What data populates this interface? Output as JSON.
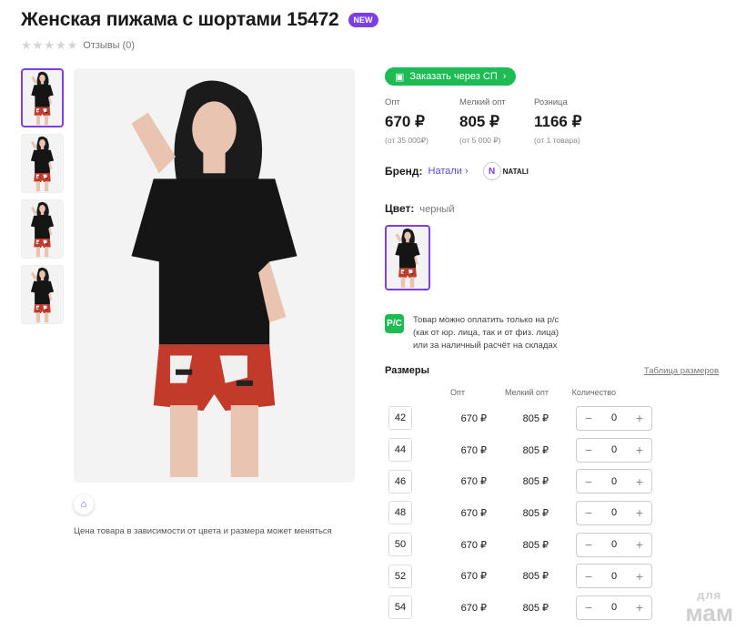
{
  "product": {
    "title": "Женская пижама с шортами 15472",
    "badge": "NEW",
    "reviews": "Отзывы (0)"
  },
  "gallery": {
    "price_note": "Цена товара в зависимости от цвета и размера может меняться"
  },
  "order": {
    "sp_button": "Заказать через СП"
  },
  "prices": [
    {
      "label": "Опт",
      "value": "670 ₽",
      "sub": "(от 35 000₽)"
    },
    {
      "label": "Мелкий опт",
      "value": "805 ₽",
      "sub": "(от 5 000 ₽)"
    },
    {
      "label": "Розница",
      "value": "1166 ₽",
      "sub": "(от 1 товара)"
    }
  ],
  "brand": {
    "label": "Бренд:",
    "name": "Натали",
    "logo_text": "NATALI"
  },
  "color": {
    "label": "Цвет:",
    "value": "черный"
  },
  "payment": {
    "icon_text": "Р/С",
    "lines": [
      "Товар можно оплатить только на р/с",
      "(как от юр. лица, так и от физ. лица)",
      "или за наличный расчёт на складах"
    ]
  },
  "sizes": {
    "title": "Размеры",
    "chart_link": "Таблица размеров",
    "headers": {
      "opt": "Опт",
      "small_opt": "Мелкий опт",
      "qty": "Количество"
    },
    "rows": [
      {
        "size": "42",
        "opt": "670 ₽",
        "small": "805 ₽",
        "qty": "0"
      },
      {
        "size": "44",
        "opt": "670 ₽",
        "small": "805 ₽",
        "qty": "0"
      },
      {
        "size": "46",
        "opt": "670 ₽",
        "small": "805 ₽",
        "qty": "0"
      },
      {
        "size": "48",
        "opt": "670 ₽",
        "small": "805 ₽",
        "qty": "0"
      },
      {
        "size": "50",
        "opt": "670 ₽",
        "small": "805 ₽",
        "qty": "0"
      },
      {
        "size": "52",
        "opt": "670 ₽",
        "small": "805 ₽",
        "qty": "0"
      },
      {
        "size": "54",
        "opt": "670 ₽",
        "small": "805 ₽",
        "qty": "0"
      }
    ]
  },
  "watermark": {
    "line1": "для",
    "line2": "мам"
  },
  "colors": {
    "accent": "#7b3fe4",
    "green": "#1dbb54",
    "link": "#5a4ad1"
  }
}
